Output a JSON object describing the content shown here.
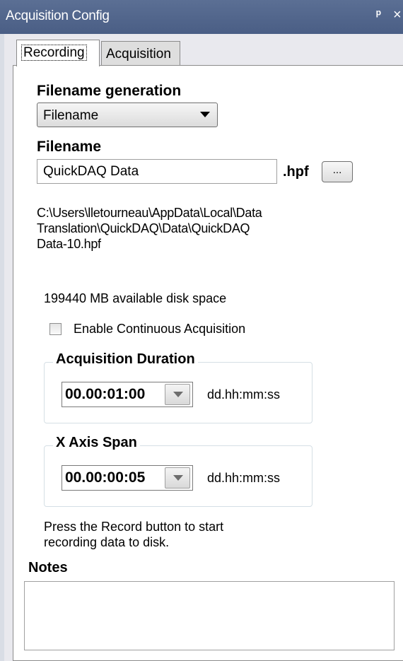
{
  "window": {
    "title": "Acquisition Config",
    "pin_glyph": "ᵖ",
    "close_glyph": "×",
    "pin_icon": "pin-icon",
    "close_icon": "close-icon"
  },
  "tabs": [
    {
      "label": "Recording",
      "active": true
    },
    {
      "label": "Acquisition",
      "active": false
    }
  ],
  "recording": {
    "filename_generation_label": "Filename generation",
    "filename_generation_value": "Filename",
    "filename_label": "Filename",
    "filename_value": "QuickDAQ Data",
    "extension": ".hpf",
    "browse_label": "...",
    "path_line1": "C:\\Users\\lletourneau\\AppData\\Local\\Data",
    "path_line2": "Translation\\QuickDAQ\\Data\\QuickDAQ",
    "path_line3": "Data-10.hpf",
    "disk_space": "199440 MB available disk space",
    "continuous_label": "Enable Continuous Acquisition",
    "continuous_checked": false,
    "duration": {
      "legend": "Acquisition Duration",
      "value": "00.00:01:00",
      "unit": "dd.hh:mm:ss"
    },
    "span": {
      "legend": "X Axis Span",
      "value": "00.00:00:05",
      "unit": "dd.hh:mm:ss"
    },
    "hint_line1": "Press the Record button to start",
    "hint_line2": "recording data to disk.",
    "notes_label": "Notes",
    "notes_value": ""
  },
  "colors": {
    "titlebar": "#4a5e85",
    "frame": "#e9e9ee",
    "panel": "#ffffff"
  }
}
